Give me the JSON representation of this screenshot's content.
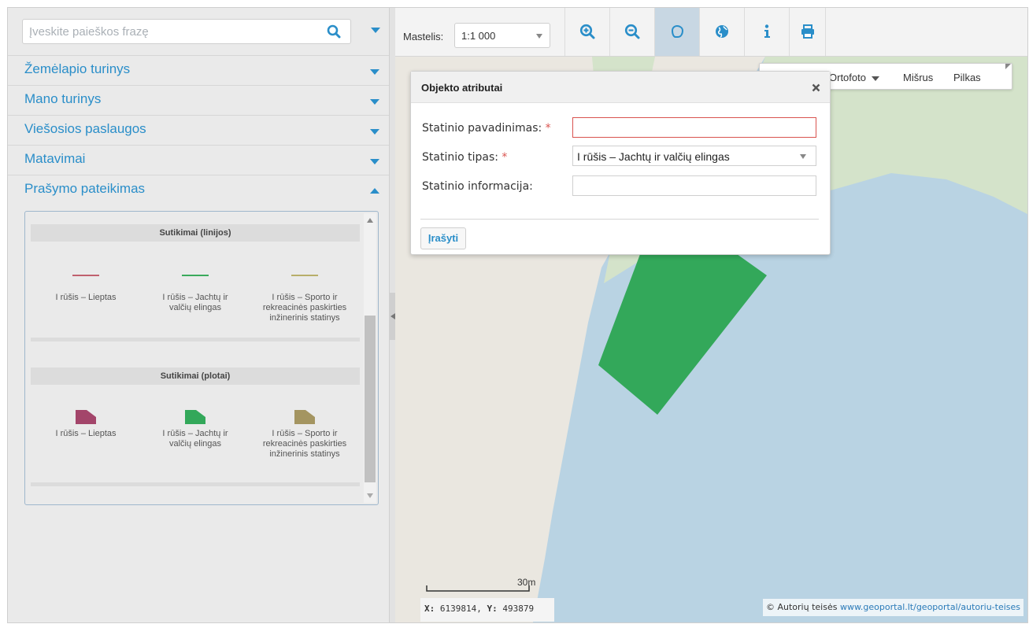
{
  "search": {
    "placeholder": "Įveskite paieškos frazę"
  },
  "sidebar": {
    "items": [
      {
        "label": "Žemėlapio turinys"
      },
      {
        "label": "Mano turinys"
      },
      {
        "label": "Viešosios paslaugos"
      },
      {
        "label": "Matavimai"
      },
      {
        "label": "Prašymo pateikimas"
      }
    ]
  },
  "legend": {
    "lines_header": "Sutikimai (linijos)",
    "areas_header": "Sutikimai (plotai)",
    "lines": [
      {
        "l1": "I rūšis – Lieptas",
        "l2": "",
        "l3": "",
        "color": "#c0606e"
      },
      {
        "l1": "I rūšis – Jachtų ir",
        "l2": "valčių elingas",
        "l3": "",
        "color": "#3aaa5c"
      },
      {
        "l1": "I rūšis – Sporto ir",
        "l2": "rekreacinės paskirties",
        "l3": "inžinerinis statinys",
        "color": "#b8ae6a"
      }
    ],
    "areas": [
      {
        "l1": "I rūšis – Lieptas",
        "l2": "",
        "l3": "",
        "color": "#a3456a"
      },
      {
        "l1": "I rūšis – Jachtų ir",
        "l2": "valčių elingas",
        "l3": "",
        "color": "#33a85a"
      },
      {
        "l1": "I rūšis – Sporto ir",
        "l2": "rekreacinės paskirties",
        "l3": "inžinerinis statinys",
        "color": "#a49561"
      }
    ]
  },
  "toolbar": {
    "scale_label": "Mastelis:",
    "scale_value": "1:1 000"
  },
  "basemap": {
    "ortofoto": "Ortofoto",
    "misrus": "Mišrus",
    "pilkas": "Pilkas"
  },
  "dialog": {
    "title": "Objekto atributai",
    "name_label": "Statinio pavadinimas:",
    "type_label": "Statinio tipas:",
    "info_label": "Statinio informacija:",
    "required_mark": "*",
    "name_value": "",
    "type_value": "I rūšis – Jachtų ir valčių elingas",
    "info_value": "",
    "save_label": "Įrašyti"
  },
  "map": {
    "scalebar_label": "30m",
    "coord_x_label": "X:",
    "coord_x": "6139814",
    "coord_y_label": "Y:",
    "coord_y": "493879",
    "attribution_text": "© Autorių teisės",
    "attribution_link": "www.geoportal.lt/geoportal/autoriu-teises"
  },
  "colors": {
    "accent": "#2a8ec9",
    "water": "#b9d3e3",
    "land": "#eae7e0",
    "vegetation": "#d4e3ca",
    "object": "#33a85a",
    "required": "#d9534f"
  }
}
